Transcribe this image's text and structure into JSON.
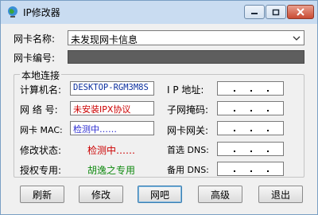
{
  "window": {
    "title": "IP修改器"
  },
  "adapter": {
    "name_label": "网卡名称:",
    "name_value": "未发现网卡信息",
    "id_label": "网卡编号:"
  },
  "group": {
    "title": "本地连接",
    "computer_name_label": "计算机名:",
    "computer_name_value": "DESKTOP-RGM3M8S",
    "network_label": "网 络 号:",
    "network_value": "未安装IPX协议",
    "mac_label": "网卡 MAC:",
    "mac_value": "检测中……",
    "status_label": "修改状态:",
    "status_value": "检测中……",
    "license_label": "授权专用:",
    "license_value": "胡逸之专用",
    "ip_label": "I P 地址:",
    "mask_label": "子网掩码:",
    "gateway_label": "网卡网关:",
    "dns1_label": "首选 DNS:",
    "dns2_label": "备用 DNS:"
  },
  "buttons": {
    "refresh": "刷新",
    "modify": "修改",
    "netbar": "网吧",
    "advanced": "高级",
    "exit": "退出"
  },
  "colors": {
    "value_blue": "#0b2f9e",
    "value_red": "#cc0000",
    "value_green": "#118a11"
  }
}
